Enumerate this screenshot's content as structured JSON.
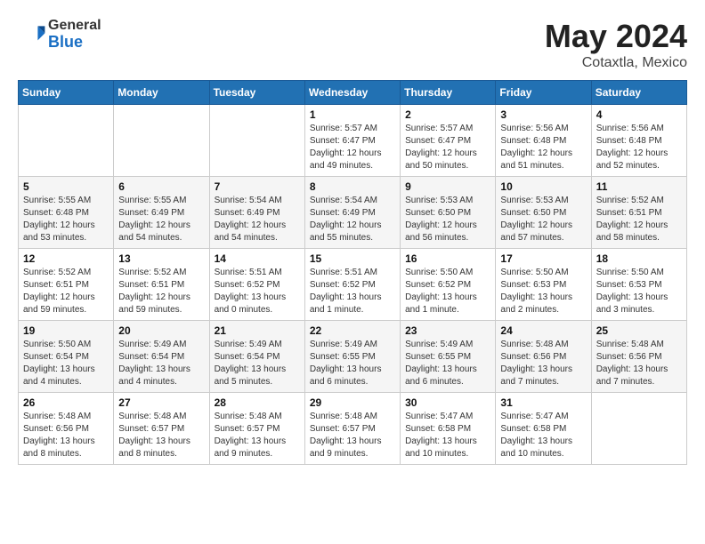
{
  "header": {
    "logo_general": "General",
    "logo_blue": "Blue",
    "title": "May 2024",
    "location": "Cotaxtla, Mexico"
  },
  "weekdays": [
    "Sunday",
    "Monday",
    "Tuesday",
    "Wednesday",
    "Thursday",
    "Friday",
    "Saturday"
  ],
  "weeks": [
    [
      {
        "day": "",
        "info": ""
      },
      {
        "day": "",
        "info": ""
      },
      {
        "day": "",
        "info": ""
      },
      {
        "day": "1",
        "info": "Sunrise: 5:57 AM\nSunset: 6:47 PM\nDaylight: 12 hours\nand 49 minutes."
      },
      {
        "day": "2",
        "info": "Sunrise: 5:57 AM\nSunset: 6:47 PM\nDaylight: 12 hours\nand 50 minutes."
      },
      {
        "day": "3",
        "info": "Sunrise: 5:56 AM\nSunset: 6:48 PM\nDaylight: 12 hours\nand 51 minutes."
      },
      {
        "day": "4",
        "info": "Sunrise: 5:56 AM\nSunset: 6:48 PM\nDaylight: 12 hours\nand 52 minutes."
      }
    ],
    [
      {
        "day": "5",
        "info": "Sunrise: 5:55 AM\nSunset: 6:48 PM\nDaylight: 12 hours\nand 53 minutes."
      },
      {
        "day": "6",
        "info": "Sunrise: 5:55 AM\nSunset: 6:49 PM\nDaylight: 12 hours\nand 54 minutes."
      },
      {
        "day": "7",
        "info": "Sunrise: 5:54 AM\nSunset: 6:49 PM\nDaylight: 12 hours\nand 54 minutes."
      },
      {
        "day": "8",
        "info": "Sunrise: 5:54 AM\nSunset: 6:49 PM\nDaylight: 12 hours\nand 55 minutes."
      },
      {
        "day": "9",
        "info": "Sunrise: 5:53 AM\nSunset: 6:50 PM\nDaylight: 12 hours\nand 56 minutes."
      },
      {
        "day": "10",
        "info": "Sunrise: 5:53 AM\nSunset: 6:50 PM\nDaylight: 12 hours\nand 57 minutes."
      },
      {
        "day": "11",
        "info": "Sunrise: 5:52 AM\nSunset: 6:51 PM\nDaylight: 12 hours\nand 58 minutes."
      }
    ],
    [
      {
        "day": "12",
        "info": "Sunrise: 5:52 AM\nSunset: 6:51 PM\nDaylight: 12 hours\nand 59 minutes."
      },
      {
        "day": "13",
        "info": "Sunrise: 5:52 AM\nSunset: 6:51 PM\nDaylight: 12 hours\nand 59 minutes."
      },
      {
        "day": "14",
        "info": "Sunrise: 5:51 AM\nSunset: 6:52 PM\nDaylight: 13 hours\nand 0 minutes."
      },
      {
        "day": "15",
        "info": "Sunrise: 5:51 AM\nSunset: 6:52 PM\nDaylight: 13 hours\nand 1 minute."
      },
      {
        "day": "16",
        "info": "Sunrise: 5:50 AM\nSunset: 6:52 PM\nDaylight: 13 hours\nand 1 minute."
      },
      {
        "day": "17",
        "info": "Sunrise: 5:50 AM\nSunset: 6:53 PM\nDaylight: 13 hours\nand 2 minutes."
      },
      {
        "day": "18",
        "info": "Sunrise: 5:50 AM\nSunset: 6:53 PM\nDaylight: 13 hours\nand 3 minutes."
      }
    ],
    [
      {
        "day": "19",
        "info": "Sunrise: 5:50 AM\nSunset: 6:54 PM\nDaylight: 13 hours\nand 4 minutes."
      },
      {
        "day": "20",
        "info": "Sunrise: 5:49 AM\nSunset: 6:54 PM\nDaylight: 13 hours\nand 4 minutes."
      },
      {
        "day": "21",
        "info": "Sunrise: 5:49 AM\nSunset: 6:54 PM\nDaylight: 13 hours\nand 5 minutes."
      },
      {
        "day": "22",
        "info": "Sunrise: 5:49 AM\nSunset: 6:55 PM\nDaylight: 13 hours\nand 6 minutes."
      },
      {
        "day": "23",
        "info": "Sunrise: 5:49 AM\nSunset: 6:55 PM\nDaylight: 13 hours\nand 6 minutes."
      },
      {
        "day": "24",
        "info": "Sunrise: 5:48 AM\nSunset: 6:56 PM\nDaylight: 13 hours\nand 7 minutes."
      },
      {
        "day": "25",
        "info": "Sunrise: 5:48 AM\nSunset: 6:56 PM\nDaylight: 13 hours\nand 7 minutes."
      }
    ],
    [
      {
        "day": "26",
        "info": "Sunrise: 5:48 AM\nSunset: 6:56 PM\nDaylight: 13 hours\nand 8 minutes."
      },
      {
        "day": "27",
        "info": "Sunrise: 5:48 AM\nSunset: 6:57 PM\nDaylight: 13 hours\nand 8 minutes."
      },
      {
        "day": "28",
        "info": "Sunrise: 5:48 AM\nSunset: 6:57 PM\nDaylight: 13 hours\nand 9 minutes."
      },
      {
        "day": "29",
        "info": "Sunrise: 5:48 AM\nSunset: 6:57 PM\nDaylight: 13 hours\nand 9 minutes."
      },
      {
        "day": "30",
        "info": "Sunrise: 5:47 AM\nSunset: 6:58 PM\nDaylight: 13 hours\nand 10 minutes."
      },
      {
        "day": "31",
        "info": "Sunrise: 5:47 AM\nSunset: 6:58 PM\nDaylight: 13 hours\nand 10 minutes."
      },
      {
        "day": "",
        "info": ""
      }
    ]
  ]
}
